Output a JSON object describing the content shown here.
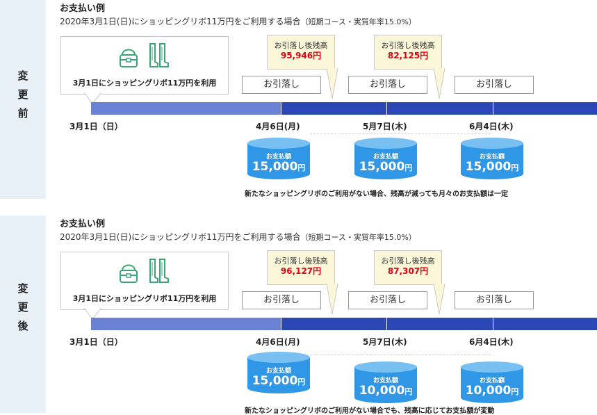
{
  "panels": [
    {
      "side_label": [
        "変",
        "更",
        "前"
      ],
      "title": "お支払い例",
      "description": "2020年3月1日(日)にショッピングリボ11万円をご利用する場合",
      "description_note": "（短期コース・実質年率15.0%）",
      "usage_label": "3月1日にショッピングリボ11万円を利用",
      "debit_label": "お引落し",
      "balance_title": "お引落し後残高",
      "balances": [
        "95,946円",
        "82,125円"
      ],
      "dates": [
        "3月1日（日）",
        "4月6日(月)",
        "5月7日(木)",
        "6月4日(木)"
      ],
      "payment_label": "お支払額",
      "payments": [
        "15,000",
        "15,000",
        "15,000"
      ],
      "yen": "円",
      "footnote": "新たなショッピングリボのご利用がない場合、残高が減っても月々のお支払額は一定"
    },
    {
      "side_label": [
        "変",
        "更",
        "後"
      ],
      "title": "お支払い例",
      "description": "2020年3月1日(日)にショッピングリボ11万円をご利用する場合",
      "description_note": "（短期コース・実質年率15.0%）",
      "usage_label": "3月1日にショッピングリボ11万円を利用",
      "debit_label": "お引落し",
      "balance_title": "お引落し後残高",
      "balances": [
        "96,127円",
        "87,307円"
      ],
      "dates": [
        "3月1日（日）",
        "4月6日(月)",
        "5月7日(木)",
        "6月4日(木)"
      ],
      "payment_label": "お支払額",
      "payments": [
        "15,000",
        "10,000",
        "10,000"
      ],
      "yen": "円",
      "footnote": "新たなショッピングリボのご利用がない場合でも、残高に応じてお支払額が変動"
    }
  ],
  "colors": {
    "sidebar": "#e9f1f8",
    "bar_light": "#6a82d6",
    "bar_dark": "#2b47b4",
    "cylinder": "#2f97e6",
    "balance_bg": "#fcf7d9",
    "balance_value": "#e60012",
    "icon": "#3aa676"
  },
  "icons": [
    "bag-icon",
    "boots-icon"
  ]
}
